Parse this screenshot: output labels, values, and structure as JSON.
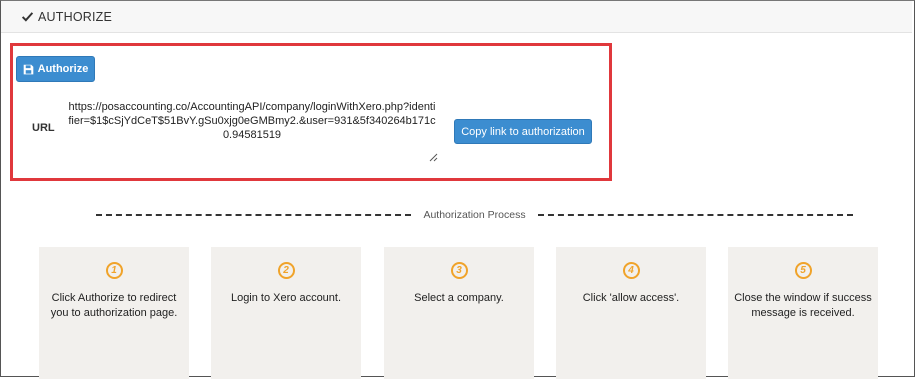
{
  "header": {
    "title": "AUTHORIZE",
    "icon": "check-icon"
  },
  "authorize": {
    "button_label": "Authorize",
    "button_icon": "save-icon",
    "url_label": "URL",
    "url_value": "https://posaccounting.co/AccountingAPI/company/loginWithXero.php?identifier=$1$cSjYdCeT$51BvY.gSu0xjg0eGMBmy2.&user=931&5f340264b171c0.94581519",
    "copy_button_label": "Copy link to authorization"
  },
  "process": {
    "title": "Authorization Process",
    "steps": [
      {
        "number": "1",
        "text": "Click Authorize to redirect you to authorization page."
      },
      {
        "number": "2",
        "text": "Login to Xero account."
      },
      {
        "number": "3",
        "text": "Select a company."
      },
      {
        "number": "4",
        "text": "Click 'allow access'."
      },
      {
        "number": "5",
        "text": "Close the window if success message is received."
      }
    ]
  },
  "colors": {
    "primary_button": "#3c8dd0",
    "highlight_border": "#e0383c",
    "step_number": "#f0a32a",
    "step_background": "#f2f0ed"
  }
}
